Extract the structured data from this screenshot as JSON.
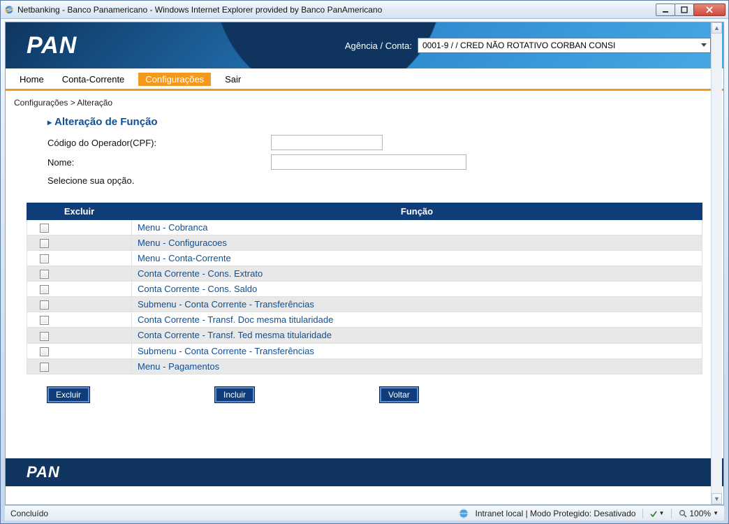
{
  "window": {
    "title": "Netbanking - Banco Panamericano - Windows Internet Explorer provided by Banco PanAmericano"
  },
  "banner": {
    "logo_text": "PAN",
    "account_label": "Agência / Conta:",
    "account_value": "0001-9 /                       / CRED NÃO ROTATIVO CORBAN CONSI"
  },
  "menu": {
    "items": [
      "Home",
      "Conta-Corrente",
      "Configurações",
      "Sair"
    ],
    "active_index": 2
  },
  "breadcrumb": "Configurações > Alteração",
  "section_title": "Alteração de Função",
  "form": {
    "cpf_label": "Código do Operador(CPF):",
    "cpf_value": "",
    "nome_label": "Nome:",
    "nome_value": "",
    "instruction": "Selecione sua opção."
  },
  "table": {
    "headers": {
      "excluir": "Excluir",
      "funcao": "Função"
    },
    "rows": [
      "Menu - Cobranca",
      "Menu - Configuracoes",
      "Menu - Conta-Corrente",
      "Conta Corrente - Cons. Extrato",
      "Conta Corrente - Cons. Saldo",
      "Submenu - Conta Corrente - Transferências",
      "Conta Corrente - Transf. Doc mesma titularidade",
      "Conta Corrente - Transf. Ted mesma titularidade",
      "Submenu - Conta Corrente - Transferências",
      "Menu - Pagamentos"
    ]
  },
  "buttons": {
    "excluir": "Excluir",
    "incluir": "Incluir",
    "voltar": "Voltar"
  },
  "footer": {
    "logo_text": "PAN"
  },
  "statusbar": {
    "left": "Concluído",
    "zone": "Intranet local | Modo Protegido: Desativado",
    "zoom": "100%"
  }
}
